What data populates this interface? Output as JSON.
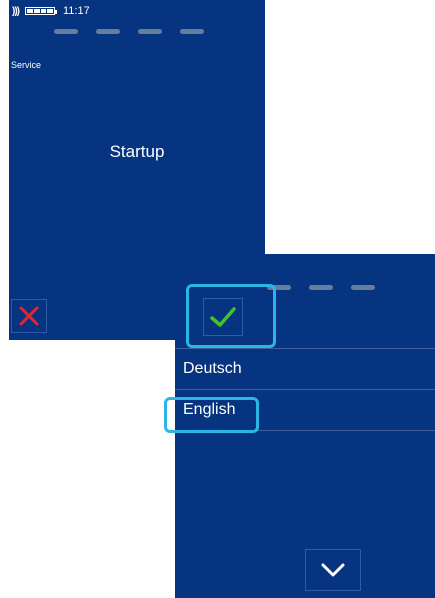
{
  "screen1": {
    "status": {
      "time": "11:17",
      "nfc_icon": "contactless-icon",
      "battery_icon": "battery-icon"
    },
    "header": "Service",
    "title": "Startup",
    "cancel_icon": "close-icon",
    "ok_icon": "check-icon"
  },
  "screen2": {
    "languages": [
      "Deutsch",
      "English"
    ],
    "selected_language": "English",
    "scroll_icon": "chevron-down-icon"
  },
  "colors": {
    "screen_bg": "#063480",
    "highlight": "#29b6e6",
    "cancel": "#e3262b",
    "confirm": "#43c22a"
  }
}
